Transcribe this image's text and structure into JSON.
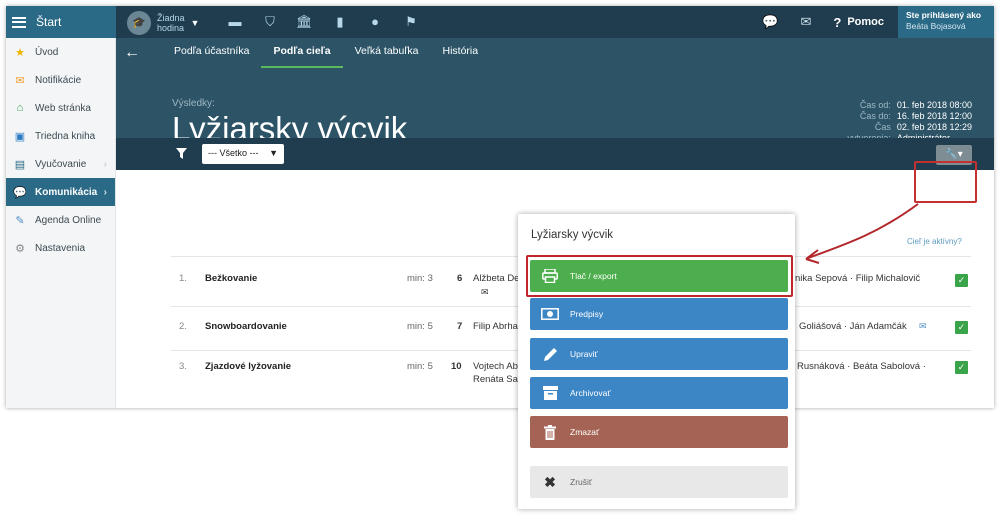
{
  "topbar": {
    "start_label": "Štart",
    "hodina_line1": "Žiadna",
    "hodina_line2": "hodina",
    "help_label": "Pomoc",
    "user_line1": "Ste prihlásený ako",
    "user_line2": "Beáta Bojasová"
  },
  "sidebar": {
    "items": [
      {
        "label": "Úvod",
        "icon": "star-icon"
      },
      {
        "label": "Notifikácie",
        "icon": "envelope-icon"
      },
      {
        "label": "Web stránka",
        "icon": "home-icon"
      },
      {
        "label": "Triedna kniha",
        "icon": "book-icon"
      },
      {
        "label": "Vyučovanie",
        "icon": "teaching-icon"
      },
      {
        "label": "Komunikácia",
        "icon": "chat-icon"
      },
      {
        "label": "Agenda Online",
        "icon": "pencil-icon"
      },
      {
        "label": "Nastavenia",
        "icon": "gear-icon"
      }
    ]
  },
  "tabs": [
    "Podľa účastníka",
    "Podľa cieľa",
    "Veľká tabuľka",
    "História"
  ],
  "header": {
    "results_label": "Výsledky:",
    "title": "Lyžiarsky výcvik",
    "meta": [
      {
        "key": "Čas od:",
        "value": "01. feb 2018 08:00"
      },
      {
        "key": "Čas do:",
        "value": "16. feb 2018 12:00"
      },
      {
        "key": "Čas",
        "value": "02. feb 2018 12:29"
      },
      {
        "key": "vytvorenia:",
        "value": "Administrátor"
      }
    ]
  },
  "filter": {
    "selected": "--- Všetko ---"
  },
  "table": {
    "active_header": "Cieľ je aktívny?",
    "rows": [
      {
        "num": "1.",
        "name": "Bežkovanie",
        "min": "min: 3",
        "count": "6",
        "people": "Alžbeta Der",
        "people_end": "nika Sepová · Filip Michalovič"
      },
      {
        "num": "2.",
        "name": "Snowboardovanie",
        "min": "min: 5",
        "count": "7",
        "people": "Filip Abrhan",
        "people_end": "Goliášová · Ján Adamčák"
      },
      {
        "num": "3.",
        "name": "Zjazdové lyžovanie",
        "min": "min: 5",
        "count": "10",
        "people": "Vojtech Abr",
        "people2": "Renáta Sab",
        "people_end": "Rusnáková · Beáta Sabolová ·"
      }
    ]
  },
  "modal": {
    "title": "Lyžiarsky výcvik",
    "buttons": {
      "print": "Tlač / export",
      "predpisy": "Predpisy",
      "edit": "Upraviť",
      "archive": "Archivovať",
      "delete": "Zmazať",
      "cancel": "Zrušiť"
    }
  },
  "colors": {
    "topbar": "#1f3d4e",
    "accent": "#2a6a87",
    "header": "#2c5366",
    "green": "#4cae4c",
    "blue": "#3d86c6",
    "delete": "#a56355",
    "highlight": "#c0272d"
  }
}
